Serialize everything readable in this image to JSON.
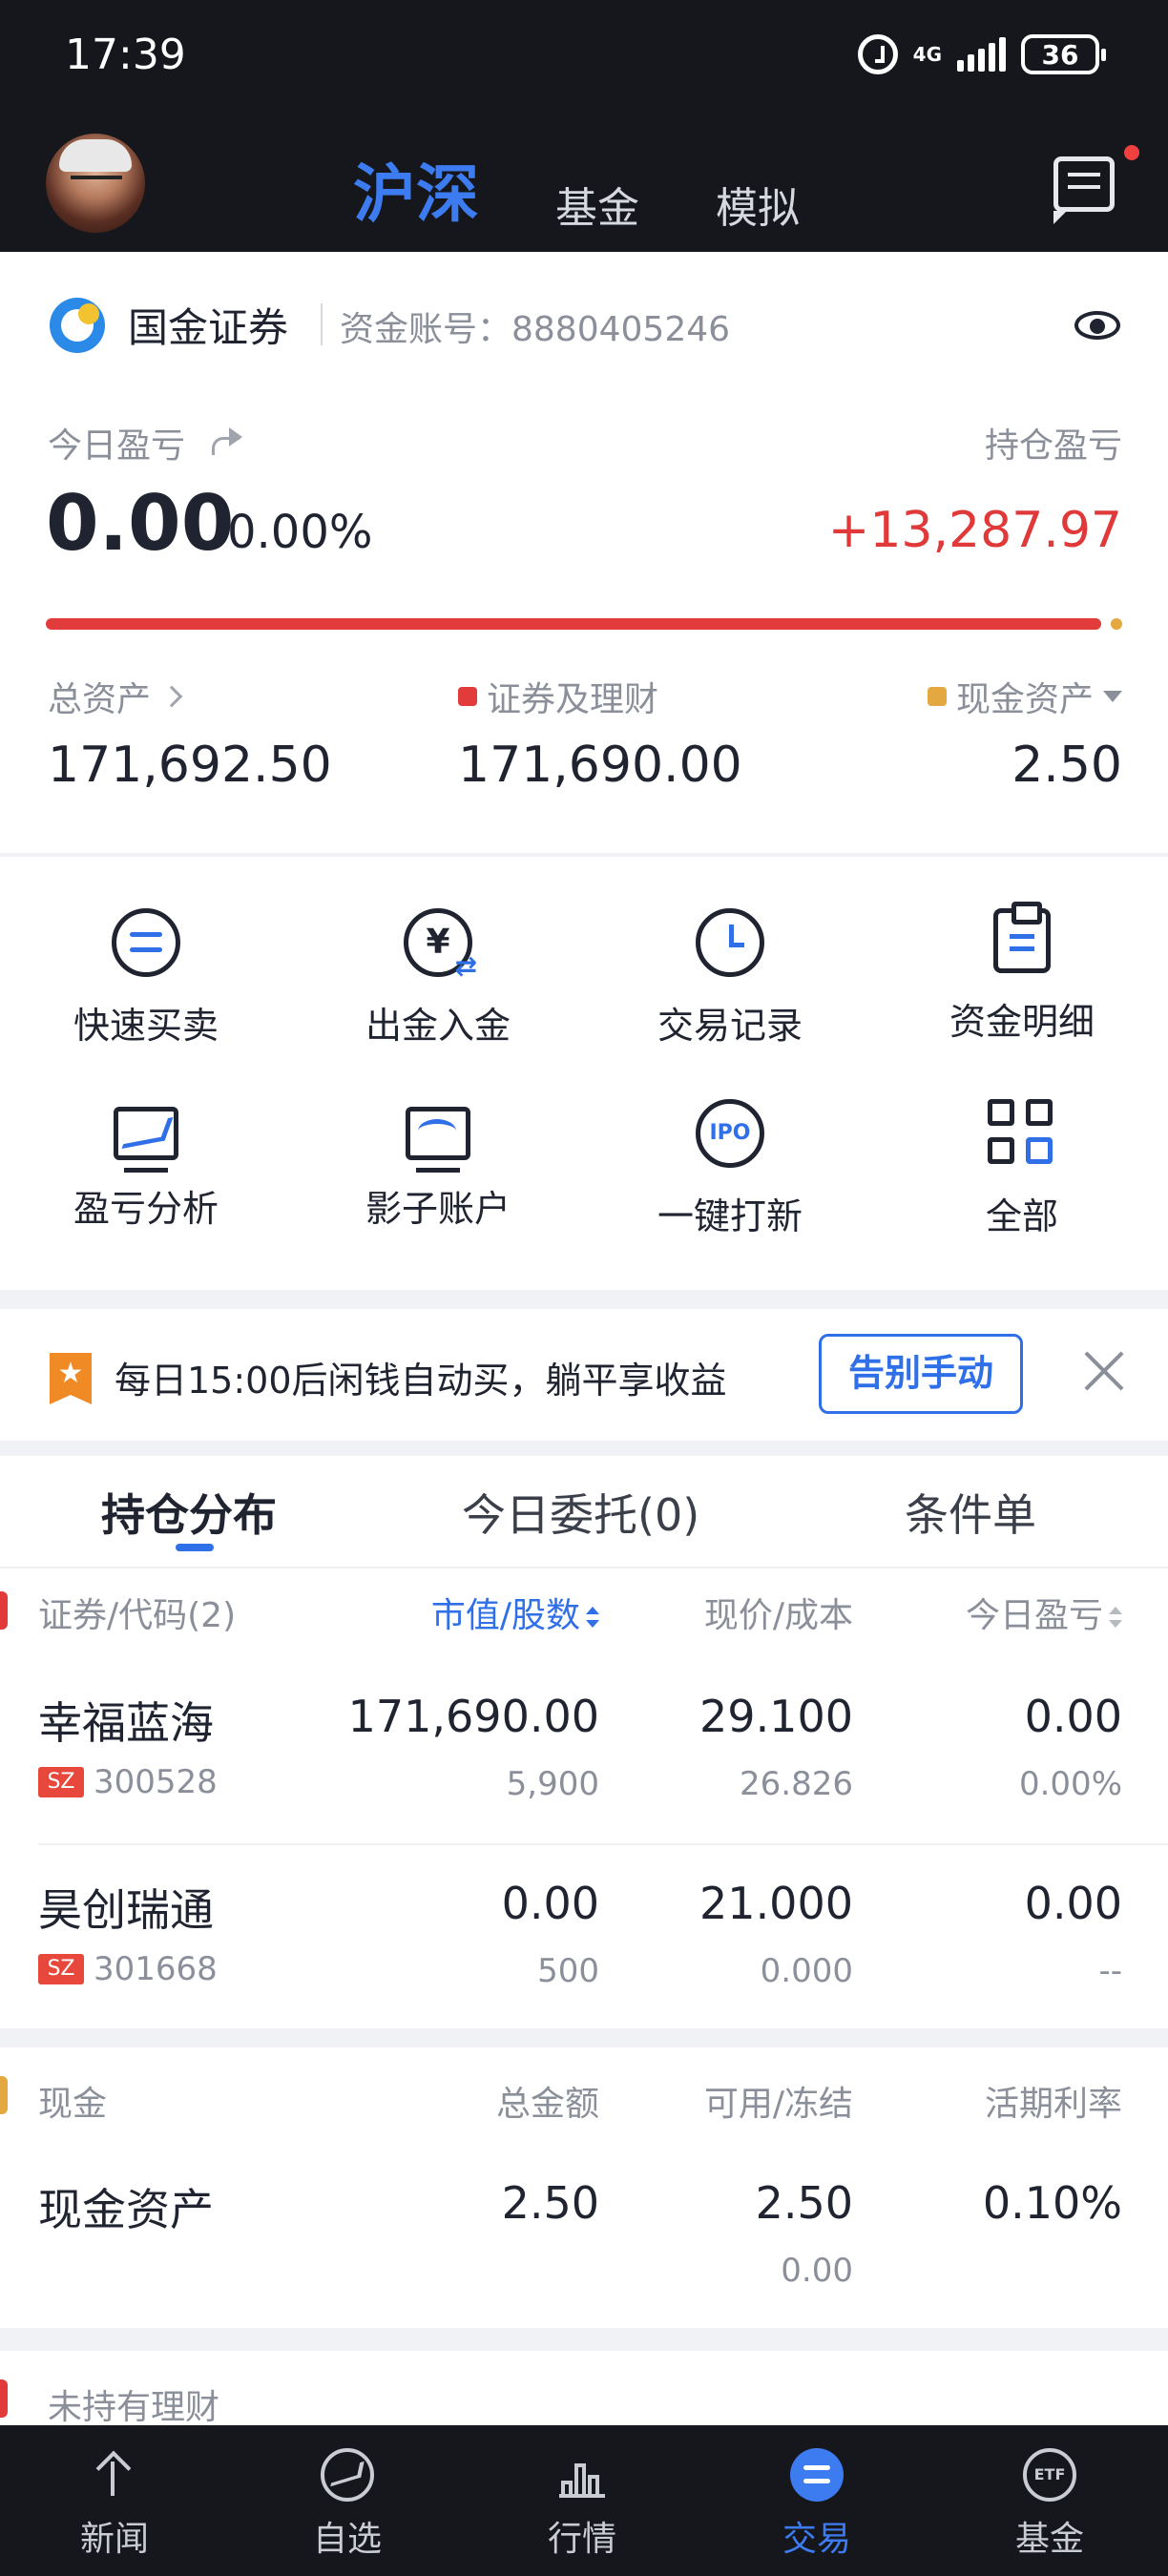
{
  "status_bar": {
    "time": "17:39",
    "network": "4G",
    "battery": "36"
  },
  "header": {
    "tabs": [
      "沪深",
      "基金",
      "模拟"
    ],
    "active_tab": "沪深"
  },
  "account": {
    "broker": "国金证券",
    "account_label": "资金账号：8880405246",
    "today_pl_label": "今日盈亏",
    "today_pl_value": "0.00",
    "today_pl_pct": "0.00%",
    "holding_pl_label": "持仓盈亏",
    "holding_pl_value": "+13,287.97",
    "total_assets_label": "总资产",
    "total_assets_value": "171,692.50",
    "securities_label": "证券及理财",
    "securities_value": "171,690.00",
    "cash_label": "现金资产",
    "cash_value": "2.50"
  },
  "shortcuts": [
    {
      "label": "快速买卖",
      "icon": "swap-icon"
    },
    {
      "label": "出金入金",
      "icon": "yen-transfer-icon"
    },
    {
      "label": "交易记录",
      "icon": "clock-icon"
    },
    {
      "label": "资金明细",
      "icon": "clipboard-icon"
    },
    {
      "label": "盈亏分析",
      "icon": "chart-monitor-icon"
    },
    {
      "label": "影子账户",
      "icon": "shadow-monitor-icon"
    },
    {
      "label": "一键打新",
      "icon": "ipo-icon",
      "icon_text": "IPO"
    },
    {
      "label": "全部",
      "icon": "grid-icon"
    }
  ],
  "banner": {
    "text": "每日15:00后闲钱自动买，躺平享收益",
    "button": "告别手动"
  },
  "positions": {
    "tabs": [
      "持仓分布",
      "今日委托(0)",
      "条件单"
    ],
    "headers": [
      "证券/代码(2)",
      "市值/股数",
      "现价/成本",
      "今日盈亏"
    ],
    "rows": [
      {
        "name": "幸福蓝海",
        "market": "SZ",
        "code": "300528",
        "market_value": "171,690.00",
        "shares": "5,900",
        "price": "29.100",
        "cost": "26.826",
        "pl": "0.00",
        "pl_pct": "0.00%"
      },
      {
        "name": "昊创瑞通",
        "market": "SZ",
        "code": "301668",
        "market_value": "0.00",
        "shares": "500",
        "price": "21.000",
        "cost": "0.000",
        "pl": "0.00",
        "pl_pct": "--"
      }
    ]
  },
  "cash_section": {
    "headers": [
      "现金",
      "总金额",
      "可用/冻结",
      "活期利率"
    ],
    "row": {
      "name": "现金资产",
      "total": "2.50",
      "available": "2.50",
      "frozen": "0.00",
      "rate": "0.10%"
    }
  },
  "no_finance_label": "未持有理财",
  "bottom_nav": [
    {
      "label": "新闻",
      "icon": "news-icon"
    },
    {
      "label": "自选",
      "icon": "watchlist-icon"
    },
    {
      "label": "行情",
      "icon": "market-icon"
    },
    {
      "label": "交易",
      "icon": "trade-icon",
      "active": true
    },
    {
      "label": "基金",
      "icon": "etf-icon",
      "icon_text": "ETF"
    }
  ],
  "colors": {
    "accent": "#2f6fe8",
    "loss_red": "#e0393a",
    "gold": "#e3a840",
    "dark_bg": "#15171d"
  }
}
